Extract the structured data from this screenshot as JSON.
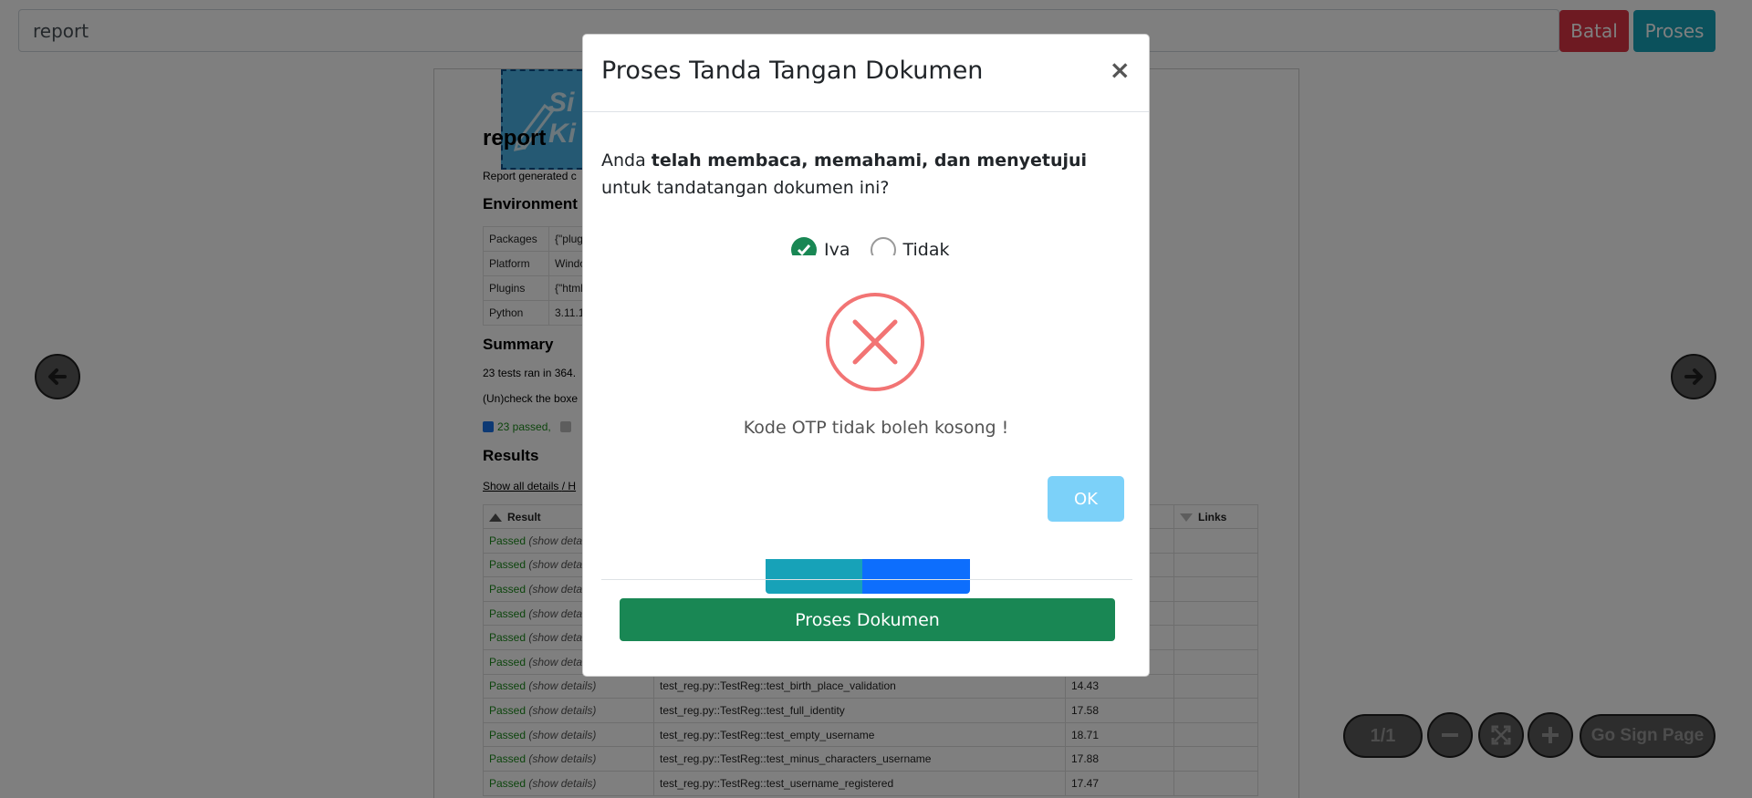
{
  "toolbar": {
    "document_name": "report",
    "batal_label": "Batal",
    "proses_label": "Proses"
  },
  "document": {
    "signature_text": "Si Ki",
    "title": "report",
    "generated_text": "Report generated c",
    "environment_heading": "Environment",
    "environment_rows": [
      {
        "key": "Packages",
        "value": "{\"plug"
      },
      {
        "key": "Platform",
        "value": "Windo"
      },
      {
        "key": "Plugins",
        "value": "{\"html\""
      },
      {
        "key": "Python",
        "value": "3.11.1"
      }
    ],
    "summary_heading": "Summary",
    "summary_line": "23 tests ran in 364.",
    "checkbox_hint": "(Un)check the boxe",
    "filter_passed": "23 passed,",
    "results_heading": "Results",
    "show_all": "Show all details",
    "show_all_sep": "/ H",
    "columns": {
      "result": "Result",
      "links": "Links"
    },
    "rows": [
      {
        "result": "Passed",
        "details": "(show deta",
        "test": "",
        "duration": ""
      },
      {
        "result": "Passed",
        "details": "(show deta",
        "test": "",
        "duration": ""
      },
      {
        "result": "Passed",
        "details": "(show deta",
        "test": "",
        "duration": ""
      },
      {
        "result": "Passed",
        "details": "(show deta",
        "test": "",
        "duration": ""
      },
      {
        "result": "Passed",
        "details": "(show deta",
        "test": "",
        "duration": ""
      },
      {
        "result": "Passed",
        "details": "(show deta",
        "test": "",
        "duration": ""
      },
      {
        "result": "Passed",
        "details": "(show details)",
        "test": "test_reg.py::TestReg::test_birth_place_validation",
        "duration": "14.43"
      },
      {
        "result": "Passed",
        "details": "(show details)",
        "test": "test_reg.py::TestReg::test_full_identity",
        "duration": "17.58"
      },
      {
        "result": "Passed",
        "details": "(show details)",
        "test": "test_reg.py::TestReg::test_empty_username",
        "duration": "18.71"
      },
      {
        "result": "Passed",
        "details": "(show details)",
        "test": "test_reg.py::TestReg::test_minus_characters_username",
        "duration": "17.88"
      },
      {
        "result": "Passed",
        "details": "(show details)",
        "test": "test_reg.py::TestReg::test_username_registered",
        "duration": "17.47"
      }
    ]
  },
  "page_nav": {
    "page_indicator": "1/1",
    "go_sign_page": "Go Sign Page"
  },
  "sign_modal": {
    "title": "Proses Tanda Tangan Dokumen",
    "close_symbol": "×",
    "question_prefix": "Anda ",
    "question_bold": "telah membaca, memahami, dan menyetujui",
    "question_suffix": " untuk tandatangan dokumen ini?",
    "option_yes": "Iya",
    "option_no": "Tidak",
    "process_button": "Proses Dokumen"
  },
  "alert": {
    "message": "Kode OTP tidak boleh kosong !",
    "ok_label": "OK",
    "icon": "error-x-icon"
  },
  "colors": {
    "danger": "#dc3545",
    "info": "#17a2b8",
    "success": "#198754",
    "alert_icon": "#f27474",
    "alert_ok": "#7cd1f9"
  }
}
